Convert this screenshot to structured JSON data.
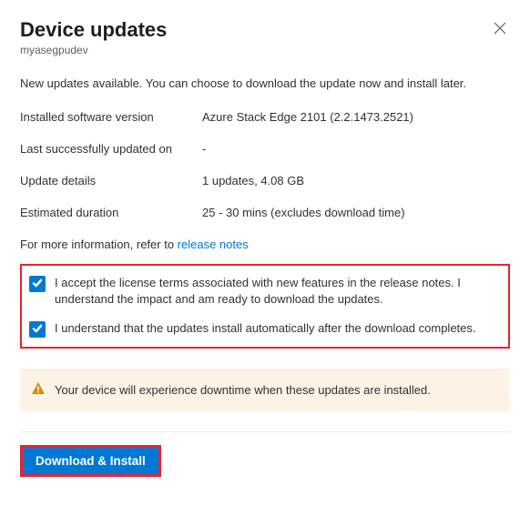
{
  "header": {
    "title": "Device updates",
    "subtitle": "myasegpudev"
  },
  "intro": "New updates available. You can choose to download the update now and install later.",
  "details": {
    "installed_label": "Installed software version",
    "installed_value": "Azure Stack Edge 2101 (2.2.1473.2521)",
    "last_updated_label": "Last successfully updated on",
    "last_updated_value": "-",
    "update_details_label": "Update details",
    "update_details_value": "1 updates, 4.08 GB",
    "duration_label": "Estimated duration",
    "duration_value": "25 - 30 mins (excludes download time)"
  },
  "info": {
    "prefix": "For more information, refer to ",
    "link": "release notes"
  },
  "checkboxes": {
    "c1": "I accept the license terms associated with new features in the release notes. I understand the impact and am ready to download the updates.",
    "c2": "I understand that the updates install automatically after the download completes."
  },
  "warning": {
    "text": "Your device will experience downtime when these updates are installed."
  },
  "actions": {
    "primary": "Download & Install"
  },
  "colors": {
    "accent": "#0078d4",
    "highlight": "#e6242c",
    "warning_bg": "#fcf2e6"
  }
}
